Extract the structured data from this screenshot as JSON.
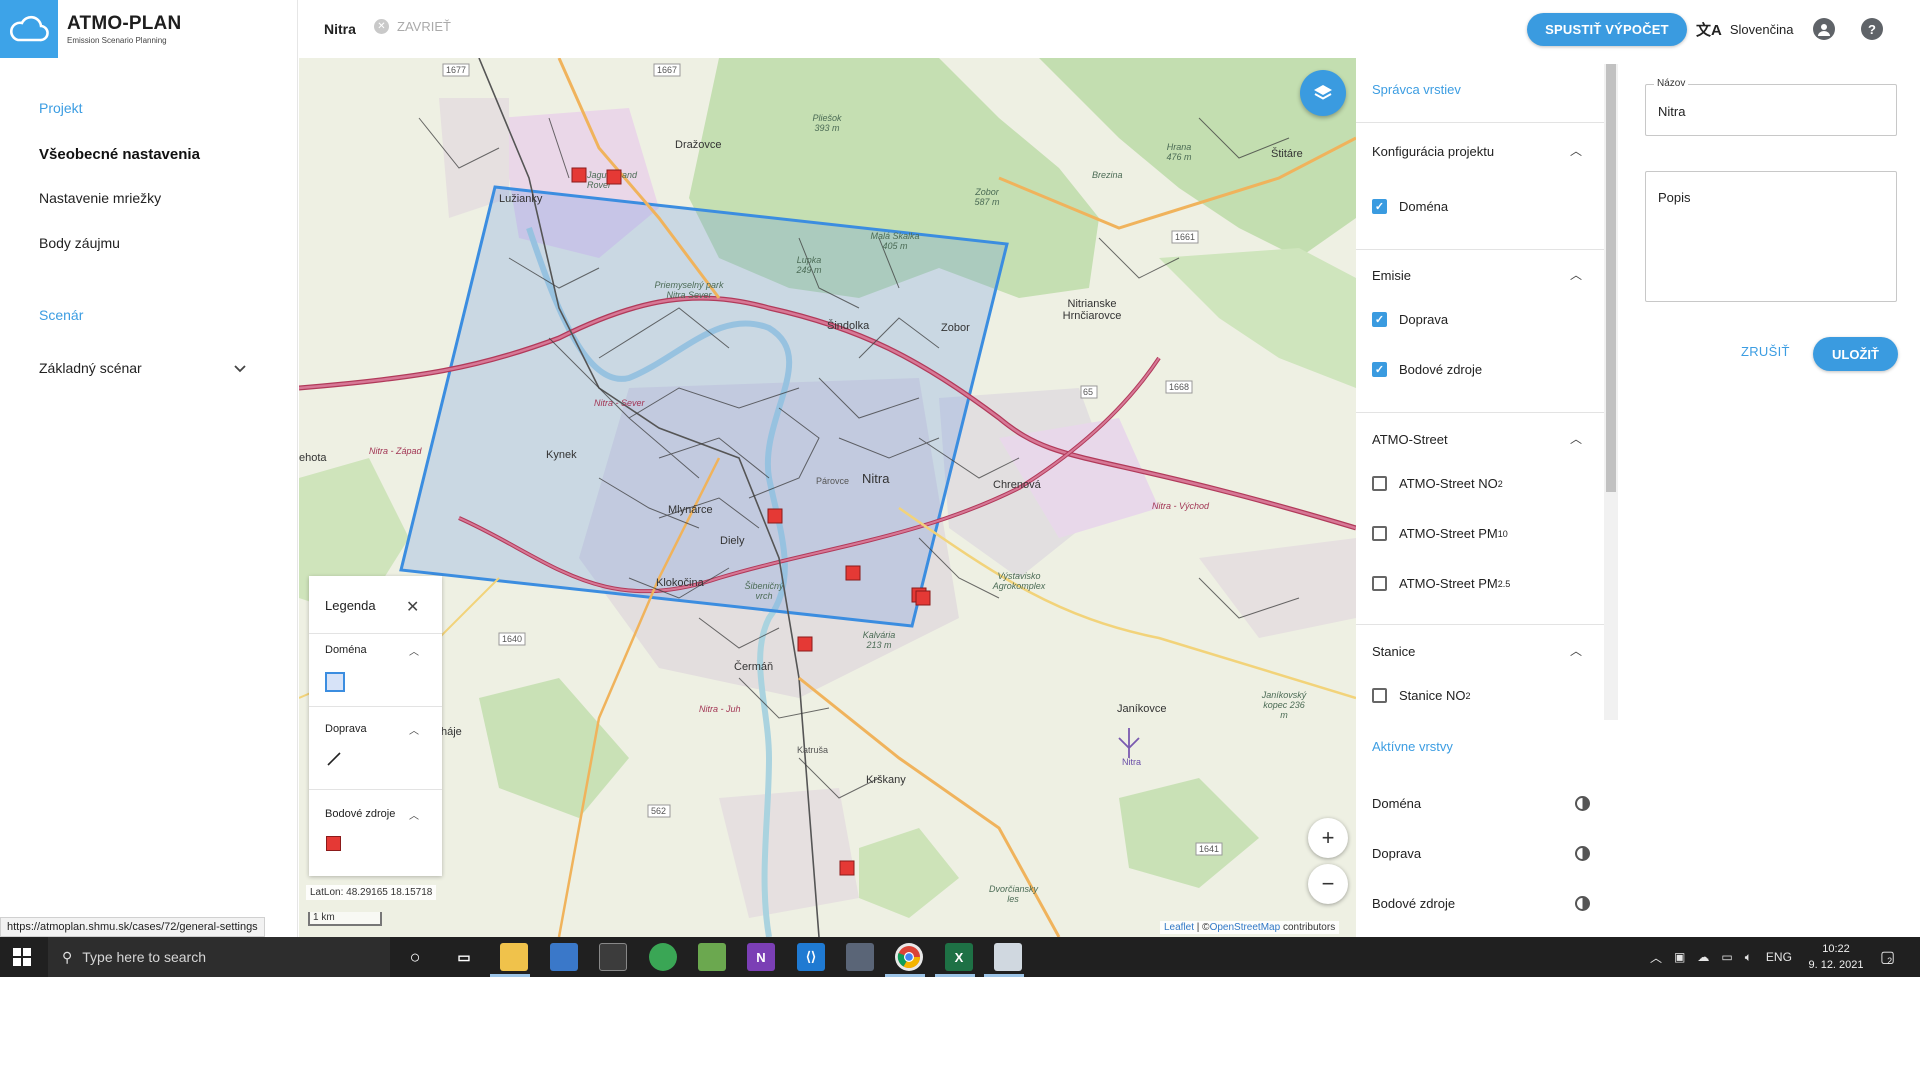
{
  "app": {
    "title": "ATMO-PLAN",
    "subtitle": "Emission Scenario Planning"
  },
  "sidebar": {
    "project_section": "Projekt",
    "project_items": [
      "Všeobecné nastavenia",
      "Nastavenie mriežky",
      "Body záujmu"
    ],
    "scenario_section": "Scenár",
    "scenario_item": "Základný scénar"
  },
  "header": {
    "case_name": "Nitra",
    "close_label": "ZAVRIEŤ",
    "run_label": "SPUSTIŤ VÝPOČET",
    "language": "Slovenčina"
  },
  "map": {
    "places": {
      "drazovce": "Dražovce",
      "luzianky": "Lužianky",
      "jaguar": "Jaguar Land Rover",
      "park": "Priemyselný park Nitra Sever",
      "sindolka": "Šindolka",
      "zobor": "Zobor",
      "hrnciarovce": "Nitrianske Hrnčiarovce",
      "stitare": "Štitáre",
      "kynek": "Kynek",
      "mlynarce": "Mlynárce",
      "diely": "Diely",
      "nitra": "Nitra",
      "chrenova": "Chrenová",
      "klokocina": "Klokočina",
      "sibenicny": "Šibeničný vrch",
      "kalvaria": "Kalvária 213 m",
      "vystavisko": "Výstavisko Agrokomplex",
      "cermam": "Čermáň",
      "krskany": "Krškany",
      "janikovce": "Janíkovce",
      "janikovsky": "Janíkovský kopec 236 m",
      "katrusa": "Katruša",
      "hajie": "háje",
      "lehota": "ehota",
      "pliesko": "Pliešok 393 m",
      "hrana": "Hrana 476 m",
      "brezina": "Brezina",
      "zobor_peak": "Zobor 587 m",
      "mala_skalka": "Malá Skalka 405 m",
      "lupka": "Lupka 249 m",
      "dvorciansky": "Dvorčiansky les",
      "parovce": "Párovce",
      "nitra_zapad": "Nitra - Západ",
      "nitra_vychod": "Nitra - Východ",
      "nitra_sever": "Nitra - Sever",
      "nitra_jug": "Nitra - Juh",
      "nitra_airport": "Nitra"
    },
    "road_numbers": [
      "1677",
      "1667",
      "1661",
      "1668",
      "1640",
      "562",
      "1641",
      "65"
    ],
    "latlon": "LatLon: 48.29165 18.15718",
    "scale": "1 km",
    "attribution_leaflet": "Leaflet",
    "attribution_rest": " | ©",
    "attribution_osm": "OpenStreetMap",
    "attribution_tail": " contributors",
    "domain_color": "#3b8de0",
    "source_color": "#e53935"
  },
  "legend": {
    "title": "Legenda",
    "sections": [
      "Doména",
      "Doprava",
      "Bodové zdroje"
    ]
  },
  "layers": {
    "title": "Správca vrstiev",
    "groups": [
      {
        "label": "Konfigurácia projektu",
        "items": [
          {
            "label": "Doména",
            "checked": true
          }
        ]
      },
      {
        "label": "Emisie",
        "items": [
          {
            "label": "Doprava",
            "checked": true
          },
          {
            "label": "Bodové zdroje",
            "checked": true
          }
        ]
      },
      {
        "label": "ATMO-Street",
        "items": [
          {
            "label": "ATMO-Street NO",
            "sub": "2",
            "checked": false
          },
          {
            "label": "ATMO-Street PM",
            "sub": "10",
            "checked": false
          },
          {
            "label": "ATMO-Street PM",
            "sub": "2.5",
            "checked": false
          }
        ]
      },
      {
        "label": "Stanice",
        "items": [
          {
            "label": "Stanice NO",
            "sub": "2",
            "checked": false
          }
        ]
      }
    ],
    "active_title": "Aktívne vrstvy",
    "active": [
      "Doména",
      "Doprava",
      "Bodové zdroje"
    ]
  },
  "form": {
    "name_label": "Názov",
    "name_value": "Nitra",
    "desc_placeholder": "Popis",
    "cancel_label": "ZRUŠIŤ",
    "save_label": "ULOŽIŤ"
  },
  "status_url": "https://atmoplan.shmu.sk/cases/72/general-settings",
  "taskbar": {
    "search_placeholder": "Type here to search",
    "lang": "ENG",
    "time": "10:22",
    "date": "9. 12. 2021",
    "notif_count": "2"
  },
  "accent": "#3a9be0"
}
